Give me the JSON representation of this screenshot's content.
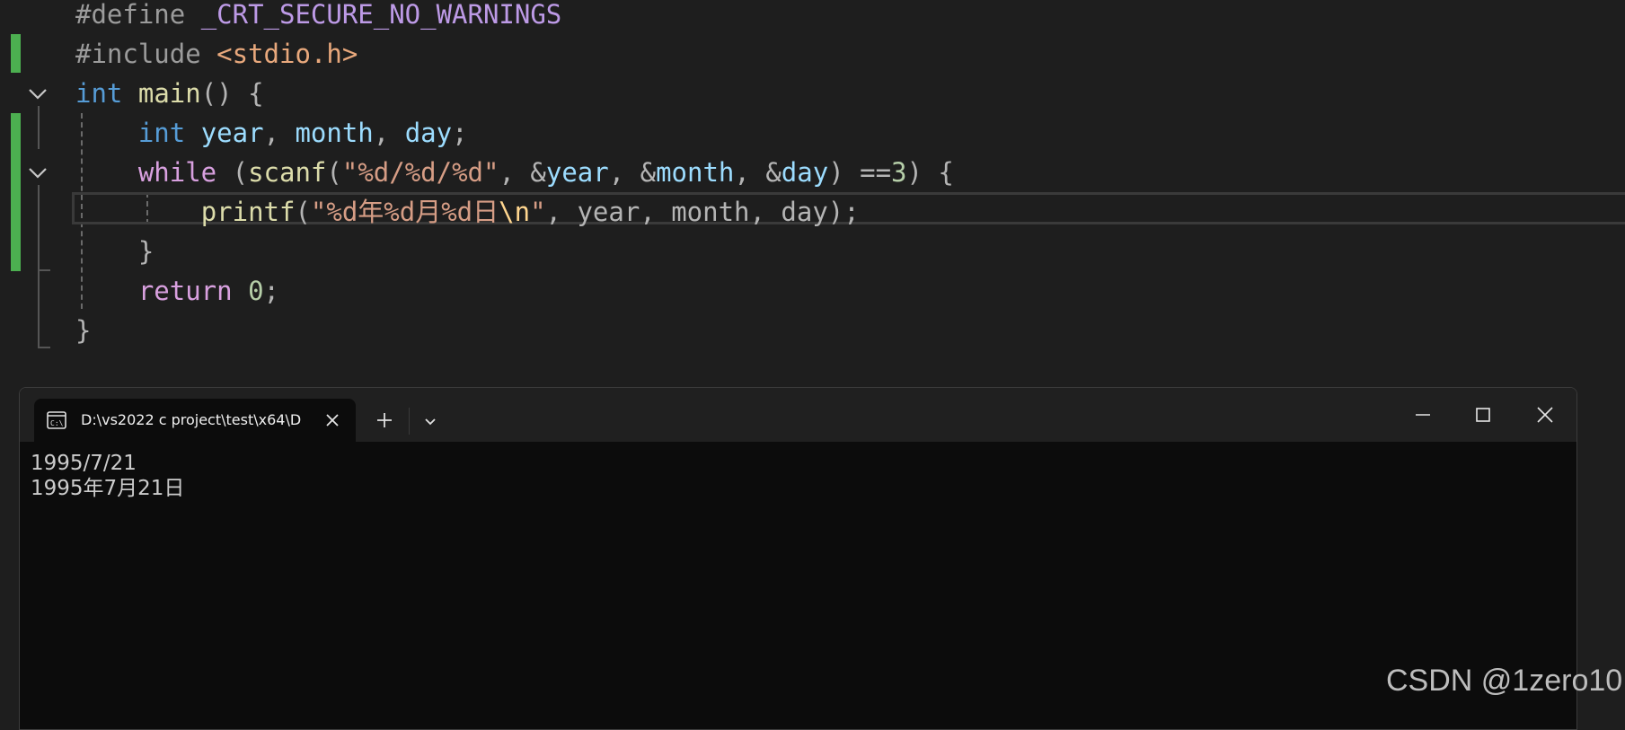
{
  "editor": {
    "lines": [
      [
        {
          "t": "#define ",
          "c": "kw-pre"
        },
        {
          "t": "_CRT_SECURE_NO_WARNINGS",
          "c": "macro"
        }
      ],
      [
        {
          "t": "#include ",
          "c": "kw-pre"
        },
        {
          "t": "<stdio.h>",
          "c": "inc"
        }
      ],
      [
        {
          "t": "int",
          "c": "kw"
        },
        {
          "t": " ",
          "c": "pun"
        },
        {
          "t": "main",
          "c": "fn"
        },
        {
          "t": "() {",
          "c": "pun"
        }
      ],
      [
        {
          "t": "    ",
          "c": "pun"
        },
        {
          "t": "int",
          "c": "kw"
        },
        {
          "t": " ",
          "c": "pun"
        },
        {
          "t": "year",
          "c": "var"
        },
        {
          "t": ", ",
          "c": "pun"
        },
        {
          "t": "month",
          "c": "var"
        },
        {
          "t": ", ",
          "c": "pun"
        },
        {
          "t": "day",
          "c": "var"
        },
        {
          "t": ";",
          "c": "pun"
        }
      ],
      [
        {
          "t": "    ",
          "c": "pun"
        },
        {
          "t": "while",
          "c": "kw2"
        },
        {
          "t": " (",
          "c": "pun"
        },
        {
          "t": "scanf",
          "c": "fn"
        },
        {
          "t": "(",
          "c": "pun"
        },
        {
          "t": "\"%d/%d/%d\"",
          "c": "str"
        },
        {
          "t": ", &",
          "c": "pun"
        },
        {
          "t": "year",
          "c": "var"
        },
        {
          "t": ", &",
          "c": "pun"
        },
        {
          "t": "month",
          "c": "var"
        },
        {
          "t": ", &",
          "c": "pun"
        },
        {
          "t": "day",
          "c": "var"
        },
        {
          "t": ") ==",
          "c": "pun"
        },
        {
          "t": "3",
          "c": "num"
        },
        {
          "t": ") {",
          "c": "pun"
        }
      ],
      [
        {
          "t": "        ",
          "c": "pun"
        },
        {
          "t": "printf",
          "c": "fn"
        },
        {
          "t": "(",
          "c": "pun"
        },
        {
          "t": "\"%d年%d月%d日",
          "c": "str"
        },
        {
          "t": "\\n",
          "c": "esc"
        },
        {
          "t": "\"",
          "c": "str"
        },
        {
          "t": ", year, month, day);",
          "c": "pun"
        }
      ],
      [
        {
          "t": "    }",
          "c": "pun"
        }
      ],
      [
        {
          "t": "    ",
          "c": "pun"
        },
        {
          "t": "return",
          "c": "kw2"
        },
        {
          "t": " ",
          "c": "pun"
        },
        {
          "t": "0",
          "c": "num"
        },
        {
          "t": ";",
          "c": "pun"
        }
      ],
      [
        {
          "t": "}",
          "c": "pun"
        }
      ]
    ]
  },
  "terminal": {
    "tab_title": "D:\\vs2022 c project\\test\\x64\\D",
    "output": [
      "1995/7/21",
      "1995年7月21日"
    ]
  },
  "colors": {
    "editor_bg": "#1e1e1e",
    "terminal_bg": "#0c0c0c",
    "change_bar": "#4caf50"
  },
  "icons": {
    "fold": "chevron-down-icon",
    "tab": "terminal-icon",
    "close": "close-icon",
    "add": "plus-icon",
    "minimize": "minimize-icon",
    "maximize": "maximize-icon"
  },
  "watermark": "CSDN @1zero10"
}
